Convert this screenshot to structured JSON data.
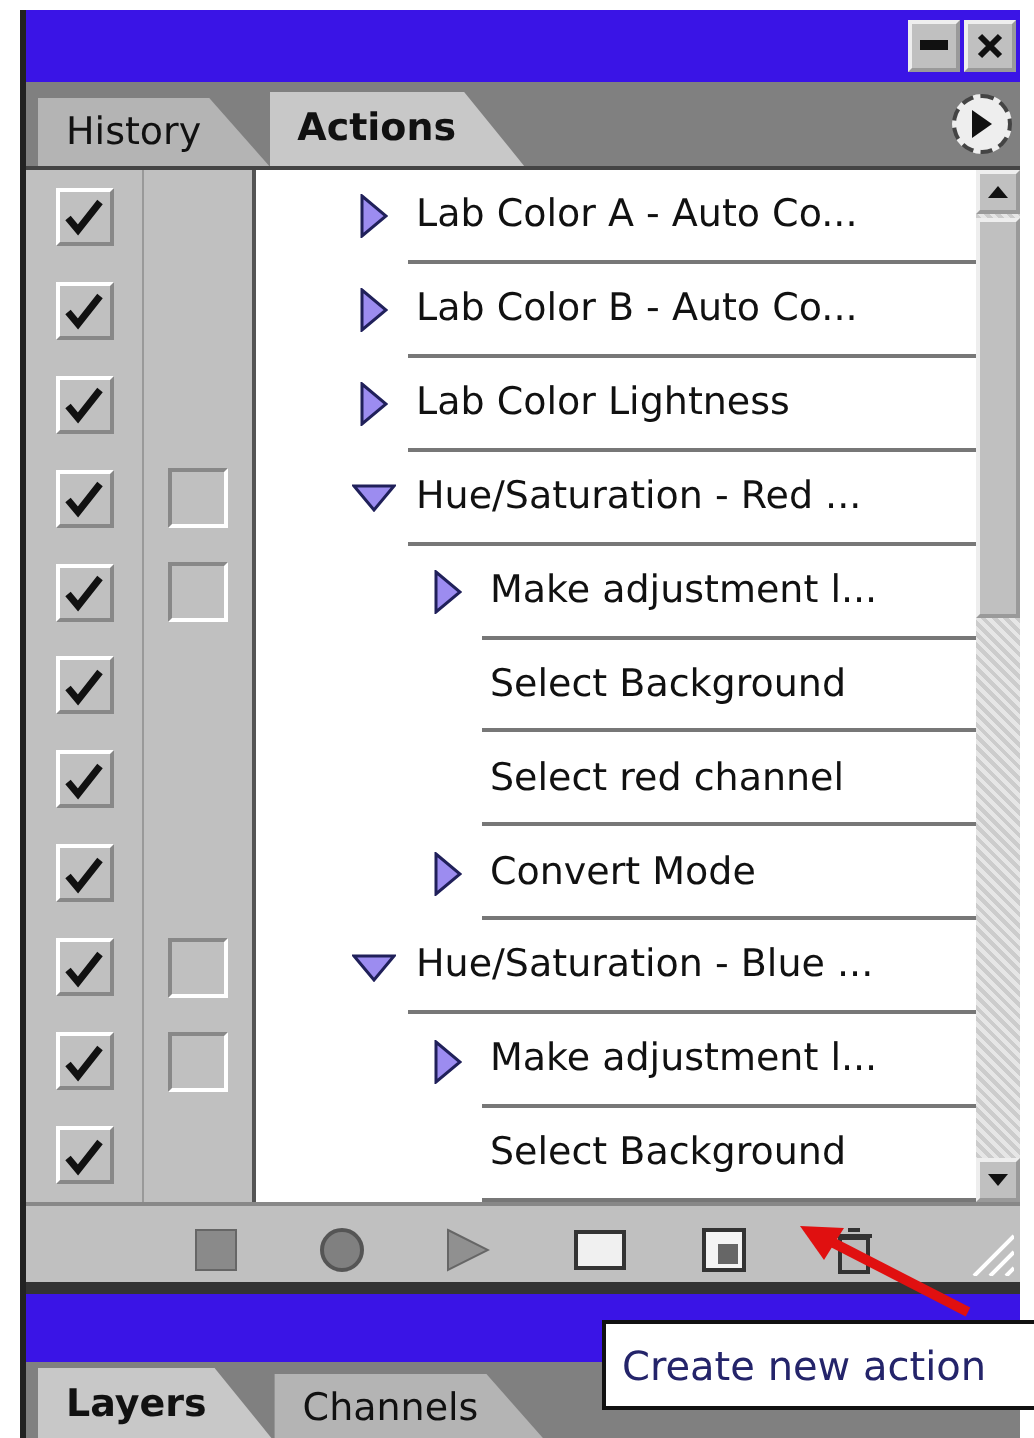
{
  "panel": {
    "tabs": [
      {
        "label": "History",
        "selected": false
      },
      {
        "label": "Actions",
        "selected": true
      }
    ]
  },
  "actions": [
    {
      "label": "Lab Color A - Auto Co...",
      "checked": true,
      "dialog_box": false,
      "expanded": false
    },
    {
      "label": "Lab Color B - Auto Co...",
      "checked": true,
      "dialog_box": false,
      "expanded": false
    },
    {
      "label": "Lab Color Lightness",
      "checked": true,
      "dialog_box": false,
      "expanded": false
    },
    {
      "label": "Hue/Saturation - Red ...",
      "checked": true,
      "dialog_box": true,
      "expanded": true,
      "children": [
        {
          "label": "Make adjustment l...",
          "checked": true,
          "dialog_box": true,
          "expanded": false
        },
        {
          "label": "Select Background",
          "checked": true,
          "dialog_box": false
        },
        {
          "label": "Select red channel",
          "checked": true,
          "dialog_box": false
        },
        {
          "label": "Convert Mode",
          "checked": true,
          "dialog_box": false,
          "expanded": false
        }
      ]
    },
    {
      "label": "Hue/Saturation - Blue ...",
      "checked": true,
      "dialog_box": true,
      "expanded": true,
      "children": [
        {
          "label": "Make adjustment l...",
          "checked": true,
          "dialog_box": true,
          "expanded": false
        },
        {
          "label": "Select Background",
          "checked": true,
          "dialog_box": false
        }
      ]
    }
  ],
  "layers_panel": {
    "tabs": [
      {
        "label": "Layers",
        "selected": true
      },
      {
        "label": "Channels",
        "selected": false
      }
    ]
  },
  "tooltip": {
    "text": "Create new action"
  }
}
